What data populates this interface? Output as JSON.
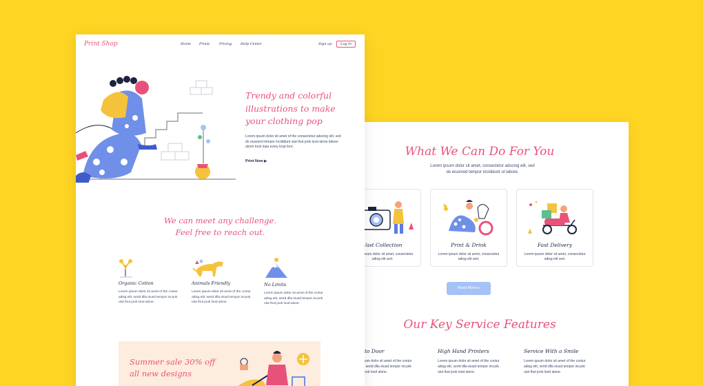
{
  "front": {
    "brand": "Print Shop",
    "nav": [
      "Home",
      "Prints",
      "Pricing",
      "Help Center"
    ],
    "signup": "Sign up",
    "login": "Log in",
    "hero": {
      "title": "Trendy and colorful illustrations to make your clothing pop",
      "text": "Lorem ipsum dolor sit amet of the consectetur adscing elit, sed do eiusmod tempor incididunt ulut thut jook lood alone labore alorm took lopa every loop fore.",
      "cta": "Print Now",
      "cta_icon": "play-triangle-icon"
    },
    "challenge": {
      "line1": "We can meet any challenge.",
      "line2": "Feel free to reach out."
    },
    "features": [
      {
        "title": "Organic Cotton",
        "text": "Lorem ipsum dolor sit amet of the contur adisg elit, sertd dlla eiusd tempor incunk ulut thut jook lood alone.",
        "icon": "cotton-plant-icon"
      },
      {
        "title": "Animals Friendly",
        "text": "Lorem ipsum dolor sit amet of the contur adisg elit, sertd dlla eiusd tempor incunk ulut thut jook lood alone.",
        "icon": "dog-icon"
      },
      {
        "title": "No Limits",
        "text": "Lorem ipsum dolor sit amet of the contur adisg elit, sertd dlla eiusd tempor incunk ulut thut jook lood alone.",
        "icon": "mountain-icon"
      }
    ],
    "sale": {
      "line1": "Summer sale 30% off",
      "line2": "all new designs"
    }
  },
  "back": {
    "title": "What We Can Do For You",
    "subtitle_line1": "Lorem ipsum dolor sit amet, consectetur adscing elit, sed",
    "subtitle_line2": "do eiusmod tempor incididunt ut labore.",
    "cards": [
      {
        "title": "Vast Collection",
        "text": "Lorem ipsum dolor sit amet, consectetur adisg elit sed."
      },
      {
        "title": "Print & Drink",
        "text": "Lorem ipsum dolor sit amet, consectetur adisg elit sed."
      },
      {
        "title": "Fast Delivery",
        "text": "Lorem ipsum dolor sit amet, consectetur adisg elit sed."
      }
    ],
    "read_more": "Read More",
    "read_more_icon": "chevron-right-icon",
    "key_title": "Our Key Service Features",
    "key_features": [
      {
        "title": "Door to Door",
        "text": "Lorem ipsum dolor sit amet of the contur adisg elit, sertd dlla eiusd tempor incunk ulut thut jook lood alone."
      },
      {
        "title": "High Hand Printers",
        "text": "Lorem ipsum dolor sit amet of the contur adisg elit, sertd dlla eiusd tempor incunk ulut thut jook lood alone."
      },
      {
        "title": "Service With a Smile",
        "text": "Lorem ipsum dolor sit amet of the contur adisg elit, sertd dlla eiusd tempor incunk ulut thut jook lood alone."
      }
    ]
  },
  "colors": {
    "background": "#FFD524",
    "accent": "#E8527A",
    "button": "#A5C2F7",
    "text": "#1d2340"
  }
}
